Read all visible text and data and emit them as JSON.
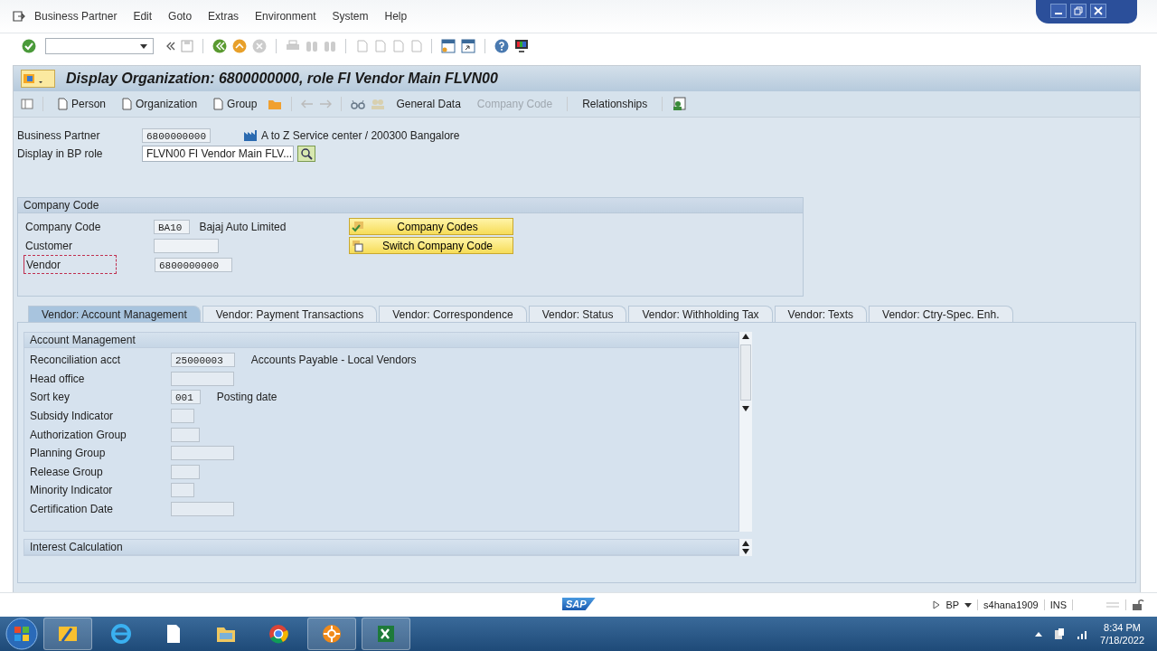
{
  "menu": [
    "Business Partner",
    "Edit",
    "Goto",
    "Extras",
    "Environment",
    "System",
    "Help"
  ],
  "title": "Display Organization: 6800000000, role FI Vendor Main FLVN00",
  "app_toolbar": [
    {
      "kind": "page",
      "label": "Person",
      "disabled": false
    },
    {
      "kind": "page",
      "label": "Organization",
      "disabled": false
    },
    {
      "kind": "page",
      "label": "Group",
      "disabled": false
    },
    {
      "kind": "text",
      "label": "General Data",
      "disabled": false
    },
    {
      "kind": "text",
      "label": "Company Code",
      "disabled": true
    },
    {
      "kind": "text",
      "label": "Relationships",
      "disabled": false
    }
  ],
  "partner": {
    "label": "Business Partner",
    "value": "6800000000",
    "description": "A to Z Service center / 200300 Bangalore"
  },
  "role": {
    "label": "Display in BP role",
    "value": "FLVN00 FI Vendor Main FLV..."
  },
  "company_box": {
    "title": "Company Code",
    "fields": [
      {
        "label": "Company Code",
        "value": "BA10",
        "description": "Bajaj Auto Limited",
        "focused": false
      },
      {
        "label": "Customer",
        "focused": false
      },
      {
        "label": "Vendor",
        "value": "6800000000",
        "focused": true
      }
    ],
    "buttons": [
      {
        "kind": "codes",
        "label": "Company Codes"
      },
      {
        "kind": "switch",
        "label": "Switch Company Code"
      }
    ]
  },
  "tabs": [
    {
      "label": "Vendor: Account Management",
      "selected": true
    },
    {
      "label": "Vendor: Payment Transactions",
      "selected": false
    },
    {
      "label": "Vendor: Correspondence",
      "selected": false
    },
    {
      "label": "Vendor: Status",
      "selected": false
    },
    {
      "label": "Vendor: Withholding Tax",
      "selected": false
    },
    {
      "label": "Vendor: Texts",
      "selected": false
    },
    {
      "label": "Vendor: Ctry-Spec. Enh.",
      "selected": false
    }
  ],
  "sections": [
    {
      "title": "Account Management",
      "fields": [
        {
          "label": "Reconciliation acct",
          "value": "25000003",
          "description": "Accounts Payable - Local Vendors"
        },
        {
          "label": "Head office"
        },
        {
          "label": "Sort key",
          "value": "001",
          "description": "Posting date"
        },
        {
          "label": "Subsidy Indicator"
        },
        {
          "label": "Authorization Group"
        },
        {
          "label": "Planning Group"
        },
        {
          "label": "Release Group"
        },
        {
          "label": "Minority Indicator"
        },
        {
          "label": "Certification Date"
        }
      ]
    },
    {
      "title": "Interest Calculation"
    }
  ],
  "status_bar": {
    "logo": "SAP",
    "system": "BP",
    "server": "s4hana1909",
    "mode": "INS"
  },
  "taskbar": {
    "time": "8:34 PM",
    "date": "7/18/2022"
  }
}
